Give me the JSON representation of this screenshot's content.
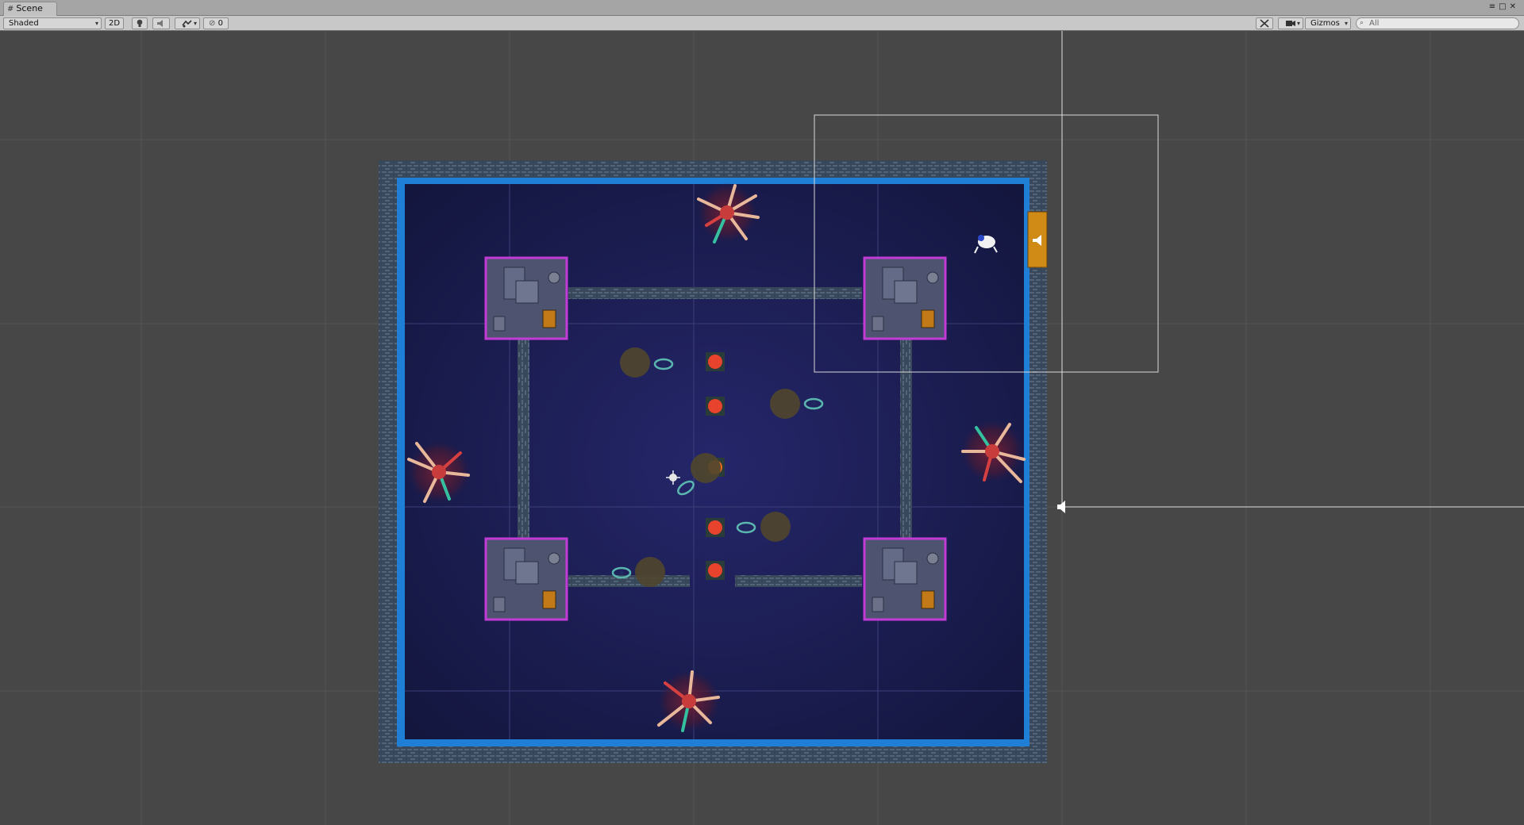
{
  "window": {
    "tab_title": "Scene",
    "tab_icon": "grid-icon"
  },
  "toolbar": {
    "draw_mode": "Shaded",
    "mode_2d": "2D",
    "light_icon": "lightbulb-icon",
    "audio_icon": "speaker-icon",
    "effects_icon": "effects-icon",
    "hidden_count": "0",
    "tools_icon": "tools-icon",
    "camera_icon": "camera-icon",
    "gizmos_label": "Gizmos",
    "search_placeholder": "All"
  },
  "colors": {
    "editor_bg": "#474747",
    "floor": "#1c1f52",
    "wall": "#3d4a5a",
    "trim": "#1f7fd6",
    "highlight": "#c23bd6",
    "enemy": "#e8432d",
    "door": "#d08a16"
  },
  "scene_objects": [
    "enemy-horde-top",
    "enemy-horde-left",
    "enemy-horde-right",
    "enemy-horde-bottom",
    "room-top-left",
    "room-top-right",
    "room-bottom-left",
    "room-bottom-right",
    "enemy-marker",
    "survivor",
    "audio-source",
    "player-ship"
  ]
}
